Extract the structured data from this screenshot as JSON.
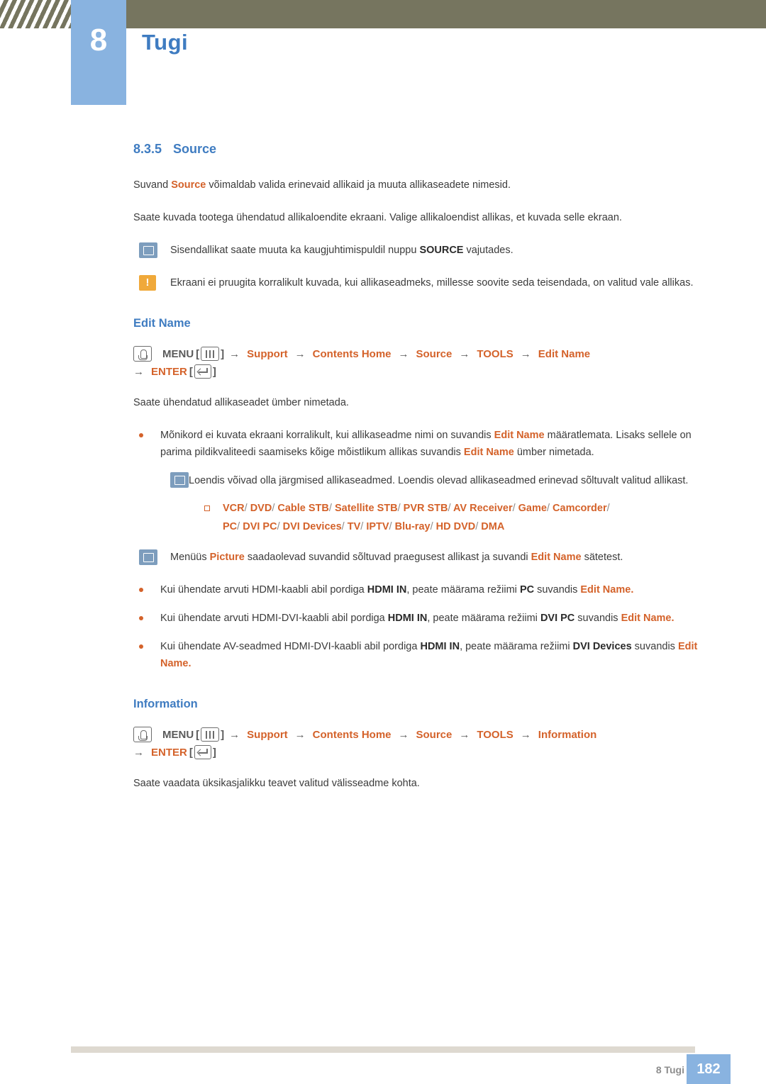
{
  "header": {
    "chapter_number": "8",
    "chapter_title": "Tugi"
  },
  "section": {
    "number": "8.3.5",
    "title": "Source"
  },
  "intro": {
    "p1_a": "Suvand ",
    "p1_b": "Source",
    "p1_c": " võimaldab valida erinevaid allikaid ja muuta allikaseadete nimesid.",
    "p2": "Saate kuvada tootega ühendatud allikaloendite ekraani. Valige allikaloendist allikas, et kuvada selle ekraan."
  },
  "notes": {
    "note1_a": "Sisendallikat saate muuta ka kaugjuhtimispuldil nuppu ",
    "note1_b": "SOURCE",
    "note1_c": " vajutades.",
    "warn1": "Ekraani ei pruugita korralikult kuvada, kui allikaseadmeks, millesse soovite seda teisendada, on valitud vale allikas.",
    "warn_glyph": "!"
  },
  "edit_name": {
    "heading": "Edit Name",
    "path": {
      "menu_label": "MENU",
      "bracket_open": "[",
      "bracket_close": "]",
      "arrow": "→",
      "items": [
        "Support",
        "Contents Home",
        "Source",
        "TOOLS",
        "Edit Name"
      ],
      "enter_label": "ENTER"
    },
    "desc": "Saate ühendatud allikaseadet ümber nimetada.",
    "bullet1_a": "Mõnikord ei kuvata ekraani korralikult, kui allikaseadme nimi on suvandis ",
    "bullet1_b": "Edit Name",
    "bullet1_c": " määratlemata. Lisaks sellele on parima pildikvaliteedi saamiseks kõige mõistlikum allikas suvandis ",
    "bullet1_d": "Edit Name",
    "bullet1_e": " ümber nimetada.",
    "nested_note": "Loendis võivad olla järgmised allikaseadmed. Loendis olevad allikaseadmed erinevad sõltuvalt valitud allikast.",
    "device_line1": [
      "VCR",
      "DVD",
      "Cable STB",
      "Satellite STB",
      "PVR STB",
      "AV Receiver",
      "Game",
      "Camcorder"
    ],
    "device_line2": [
      "PC",
      "DVI PC",
      "DVI Devices",
      "TV",
      "IPTV",
      "Blu-ray",
      "HD DVD",
      "DMA"
    ],
    "device_separator": "/",
    "note2_a": "Menüüs ",
    "note2_b": "Picture",
    "note2_c": " saadaolevad suvandid sõltuvad praegusest allikast ja suvandi ",
    "note2_d": "Edit Name",
    "note2_e": " sätetest.",
    "bullet2_a": "Kui ühendate arvuti HDMI-kaabli abil pordiga ",
    "bullet2_b": "HDMI IN",
    "bullet2_c": ", peate määrama režiimi ",
    "bullet2_d": "PC",
    "bullet2_e": " suvandis ",
    "bullet2_f": "Edit Name",
    "bullet2_g": ".",
    "bullet3_a": "Kui ühendate arvuti HDMI-DVI-kaabli abil pordiga ",
    "bullet3_b": "HDMI IN",
    "bullet3_c": ", peate määrama režiimi ",
    "bullet3_d": "DVI PC",
    "bullet3_e": " suvandis ",
    "bullet3_f": "Edit Name",
    "bullet3_g": ".",
    "bullet4_a": "Kui ühendate AV-seadmed HDMI-DVI-kaabli abil pordiga ",
    "bullet4_b": "HDMI IN",
    "bullet4_c": ", peate määrama režiimi ",
    "bullet4_d": "DVI Devices",
    "bullet4_e": " suvandis ",
    "bullet4_f": "Edit Name",
    "bullet4_g": "."
  },
  "information": {
    "heading": "Information",
    "path": {
      "menu_label": "MENU",
      "bracket_open": "[",
      "bracket_close": "]",
      "arrow": "→",
      "items": [
        "Support",
        "Contents Home",
        "Source",
        "TOOLS",
        "Information"
      ],
      "enter_label": "ENTER"
    },
    "desc": "Saate vaadata üksikasjalikku teavet valitud välisseadme kohta."
  },
  "footer": {
    "label": "8 Tugi",
    "page": "182"
  }
}
